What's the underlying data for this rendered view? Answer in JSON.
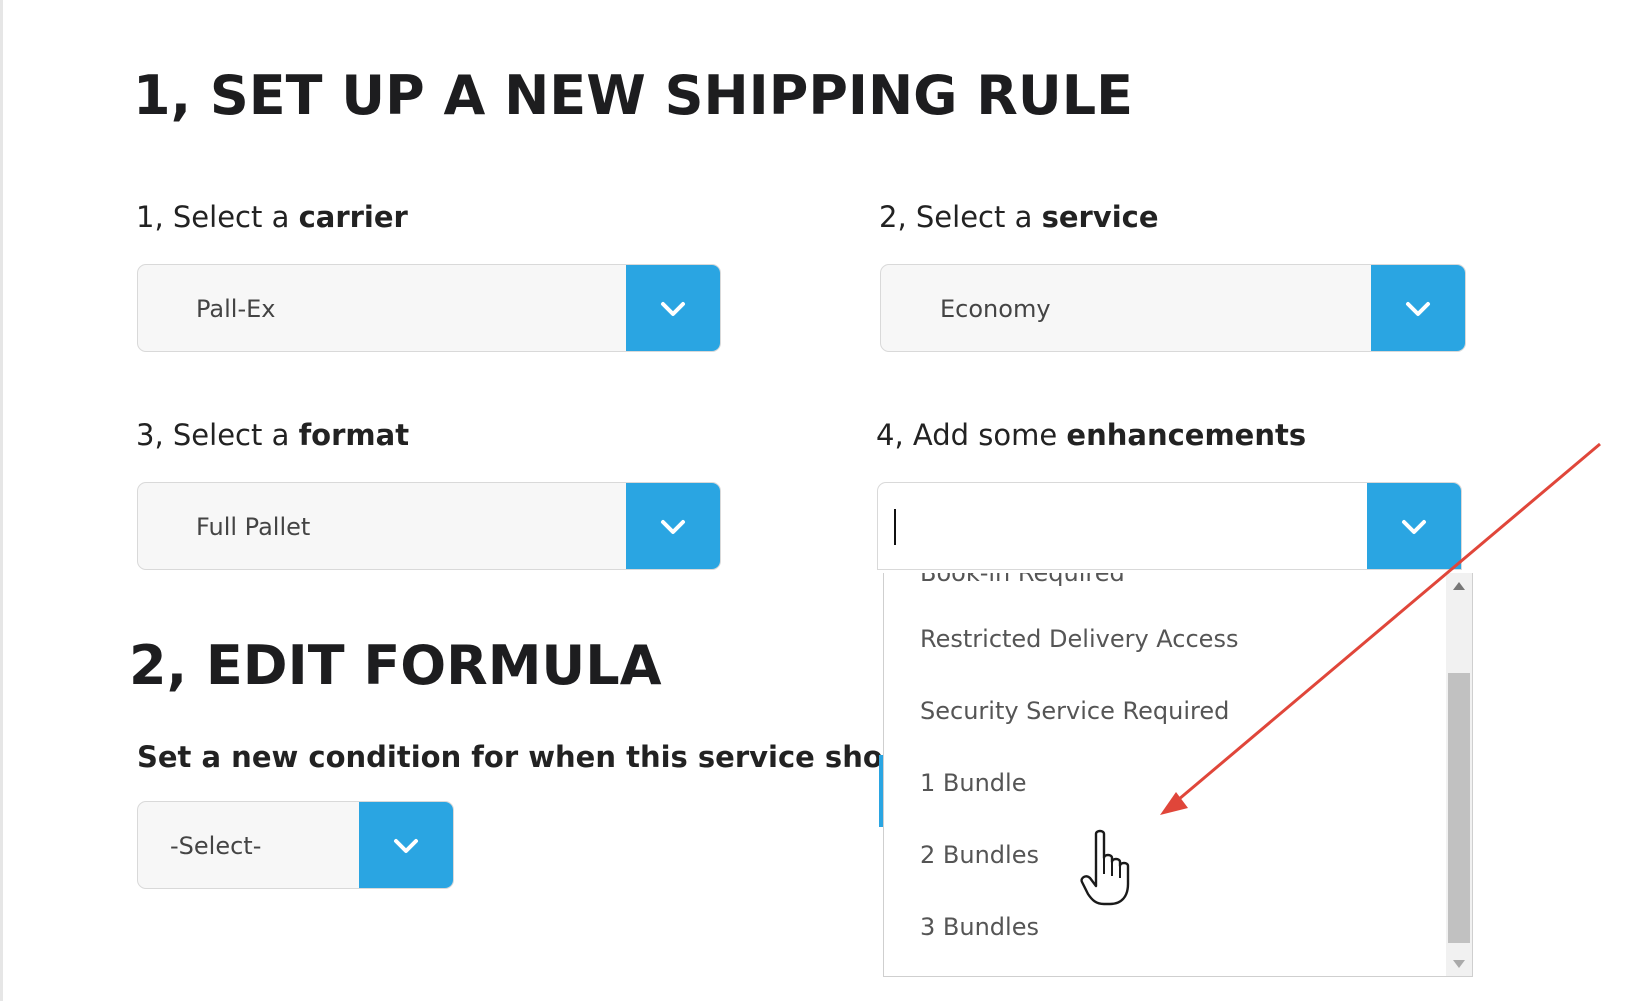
{
  "section1": {
    "title": "1, SET UP A NEW SHIPPING RULE"
  },
  "carrier": {
    "label_prefix": "1, Select a ",
    "label_bold": "carrier",
    "value": "Pall-Ex"
  },
  "service": {
    "label_prefix": "2, Select a ",
    "label_bold": "service",
    "value": "Economy"
  },
  "format": {
    "label_prefix": "3, Select a ",
    "label_bold": "format",
    "value": "Full Pallet"
  },
  "enhancements": {
    "label_prefix": "4, Add some ",
    "label_bold": "enhancements",
    "input_value": "",
    "options": [
      "Book-in Required",
      "Restricted Delivery Access",
      "Security Service Required",
      "1 Bundle",
      "2 Bundles",
      "3 Bundles"
    ],
    "hovered_option": "1 Bundle"
  },
  "section2": {
    "title": "2, EDIT FORMULA",
    "condition_label": "Set a new condition for when this service should be u",
    "condition_value": "-Select-"
  },
  "colors": {
    "accent": "#2aa5e2",
    "annotation_arrow": "#e0463a",
    "heading": "#1d1d1f"
  },
  "icons": [
    "chevron-down-icon",
    "scroll-up-icon",
    "scroll-down-icon",
    "hand-cursor-icon",
    "annotation-arrow"
  ]
}
